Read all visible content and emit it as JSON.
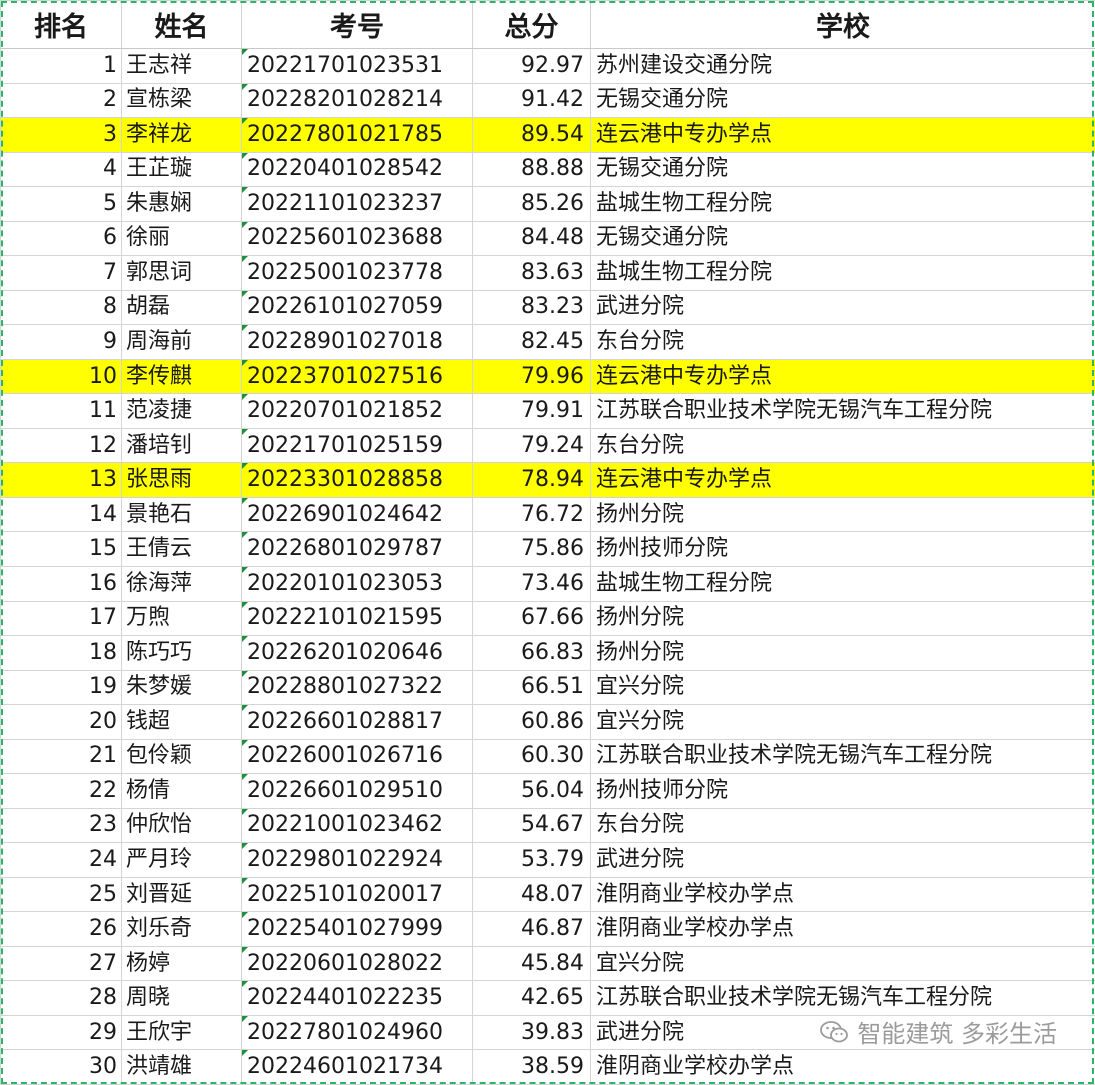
{
  "headers": [
    "排名",
    "姓名",
    "考号",
    "总分",
    "学校"
  ],
  "rows": [
    {
      "rank": "1",
      "name": "王志祥",
      "exam_no": "20221701023531",
      "score": "92.97",
      "school": "苏州建设交通分院",
      "highlight": false
    },
    {
      "rank": "2",
      "name": "宣栋梁",
      "exam_no": "20228201028214",
      "score": "91.42",
      "school": "无锡交通分院",
      "highlight": false
    },
    {
      "rank": "3",
      "name": "李祥龙",
      "exam_no": "20227801021785",
      "score": "89.54",
      "school": "连云港中专办学点",
      "highlight": true
    },
    {
      "rank": "4",
      "name": "王芷璇",
      "exam_no": "20220401028542",
      "score": "88.88",
      "school": "无锡交通分院",
      "highlight": false
    },
    {
      "rank": "5",
      "name": "朱惠娴",
      "exam_no": "20221101023237",
      "score": "85.26",
      "school": "盐城生物工程分院",
      "highlight": false
    },
    {
      "rank": "6",
      "name": "徐丽",
      "exam_no": "20225601023688",
      "score": "84.48",
      "school": "无锡交通分院",
      "highlight": false
    },
    {
      "rank": "7",
      "name": "郭思词",
      "exam_no": "20225001023778",
      "score": "83.63",
      "school": "盐城生物工程分院",
      "highlight": false
    },
    {
      "rank": "8",
      "name": "胡磊",
      "exam_no": "20226101027059",
      "score": "83.23",
      "school": "武进分院",
      "highlight": false
    },
    {
      "rank": "9",
      "name": "周海前",
      "exam_no": "20228901027018",
      "score": "82.45",
      "school": "东台分院",
      "highlight": false
    },
    {
      "rank": "10",
      "name": "李传麒",
      "exam_no": "20223701027516",
      "score": "79.96",
      "school": "连云港中专办学点",
      "highlight": true
    },
    {
      "rank": "11",
      "name": "范凌捷",
      "exam_no": "20220701021852",
      "score": "79.91",
      "school": "江苏联合职业技术学院无锡汽车工程分院",
      "highlight": false
    },
    {
      "rank": "12",
      "name": "潘培钊",
      "exam_no": "20221701025159",
      "score": "79.24",
      "school": "东台分院",
      "highlight": false
    },
    {
      "rank": "13",
      "name": "张思雨",
      "exam_no": "20223301028858",
      "score": "78.94",
      "school": "连云港中专办学点",
      "highlight": true
    },
    {
      "rank": "14",
      "name": "景艳石",
      "exam_no": "20226901024642",
      "score": "76.72",
      "school": "扬州分院",
      "highlight": false
    },
    {
      "rank": "15",
      "name": "王倩云",
      "exam_no": "20226801029787",
      "score": "75.86",
      "school": "扬州技师分院",
      "highlight": false
    },
    {
      "rank": "16",
      "name": "徐海萍",
      "exam_no": "20220101023053",
      "score": "73.46",
      "school": "盐城生物工程分院",
      "highlight": false
    },
    {
      "rank": "17",
      "name": "万煦",
      "exam_no": "20222101021595",
      "score": "67.66",
      "school": "扬州分院",
      "highlight": false
    },
    {
      "rank": "18",
      "name": "陈巧巧",
      "exam_no": "20226201020646",
      "score": "66.83",
      "school": "扬州分院",
      "highlight": false
    },
    {
      "rank": "19",
      "name": "朱梦媛",
      "exam_no": "20228801027322",
      "score": "66.51",
      "school": "宜兴分院",
      "highlight": false
    },
    {
      "rank": "20",
      "name": "钱超",
      "exam_no": "20226601028817",
      "score": "60.86",
      "school": "宜兴分院",
      "highlight": false
    },
    {
      "rank": "21",
      "name": "包伶颖",
      "exam_no": "20226001026716",
      "score": "60.30",
      "school": "江苏联合职业技术学院无锡汽车工程分院",
      "highlight": false
    },
    {
      "rank": "22",
      "name": "杨倩",
      "exam_no": "20226601029510",
      "score": "56.04",
      "school": "扬州技师分院",
      "highlight": false
    },
    {
      "rank": "23",
      "name": "仲欣怡",
      "exam_no": "20221001023462",
      "score": "54.67",
      "school": "东台分院",
      "highlight": false
    },
    {
      "rank": "24",
      "name": "严月玲",
      "exam_no": "20229801022924",
      "score": "53.79",
      "school": "武进分院",
      "highlight": false
    },
    {
      "rank": "25",
      "name": "刘晋延",
      "exam_no": "20225101020017",
      "score": "48.07",
      "school": "淮阴商业学校办学点",
      "highlight": false
    },
    {
      "rank": "26",
      "name": "刘乐奇",
      "exam_no": "20225401027999",
      "score": "46.87",
      "school": "淮阴商业学校办学点",
      "highlight": false
    },
    {
      "rank": "27",
      "name": "杨婷",
      "exam_no": "20220601028022",
      "score": "45.84",
      "school": "宜兴分院",
      "highlight": false
    },
    {
      "rank": "28",
      "name": "周晓",
      "exam_no": "20224401022235",
      "score": "42.65",
      "school": "江苏联合职业技术学院无锡汽车工程分院",
      "highlight": false
    },
    {
      "rank": "29",
      "name": "王欣宇",
      "exam_no": "20227801024960",
      "score": "39.83",
      "school": "武进分院",
      "highlight": false
    },
    {
      "rank": "30",
      "name": "洪靖雄",
      "exam_no": "20224601021734",
      "score": "38.59",
      "school": "淮阴商业学校办学点",
      "highlight": false
    }
  ],
  "watermark": {
    "text": "智能建筑 多彩生活",
    "icon": "wechat-icon"
  },
  "colors": {
    "highlight": "#ffff00",
    "frame": "#2bb56a",
    "grid": "#d4d4d4",
    "cell_marker": "#1e8f3a"
  }
}
